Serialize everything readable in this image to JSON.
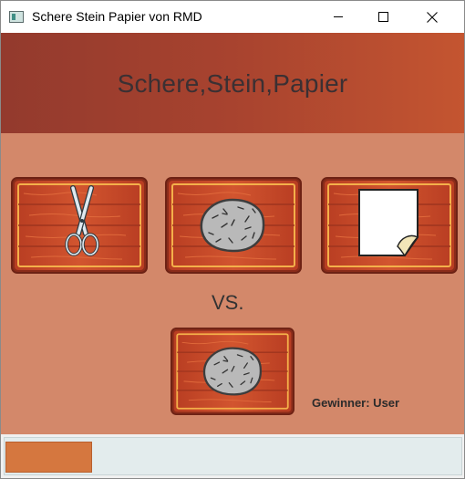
{
  "window": {
    "title": "Schere Stein Papier von RMD",
    "icon": "app-window-icon",
    "controls": [
      "minimize-icon",
      "maximize-icon",
      "close-icon"
    ]
  },
  "header": {
    "title": "Schere,Stein,Papier",
    "background_from": "#933a2d",
    "background_to": "#c45530"
  },
  "choices": [
    {
      "id": "schere",
      "icon": "scissors-icon"
    },
    {
      "id": "stein",
      "icon": "rock-icon"
    },
    {
      "id": "papier",
      "icon": "paper-icon"
    }
  ],
  "versus_label": "VS.",
  "computer_choice": {
    "icon": "rock-icon"
  },
  "result": {
    "text": "Gewinner: User"
  },
  "progress": {
    "fraction": 0.19,
    "color": "#d5773f"
  },
  "colors": {
    "page_background": "#d3886a",
    "wood_plank": "#c9462a",
    "frame_gold": "#f0a43a"
  }
}
